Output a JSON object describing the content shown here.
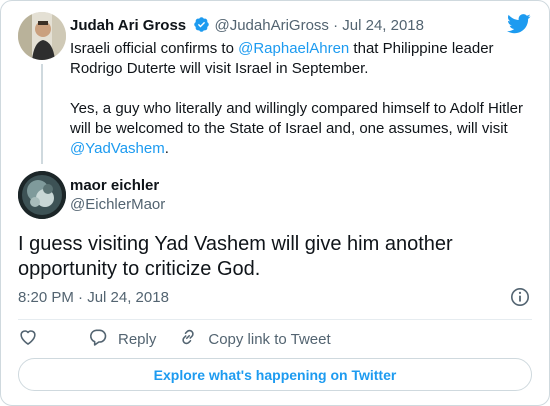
{
  "parent_tweet": {
    "author_name": "Judah Ari Gross",
    "author_handle": "@JudahAriGross",
    "separator": "·",
    "date": "Jul 24, 2018",
    "paragraph_1": {
      "before": "Israeli official confirms to ",
      "mention": "@RaphaelAhren",
      "after": " that Philippine leader Rodrigo Duterte will visit Israel in September."
    },
    "paragraph_2": {
      "before": "Yes, a guy who literally and willingly compared himself to Adolf Hitler will be welcomed to the State of Israel and, one assumes, will visit ",
      "mention": "@YadVashem",
      "after": "."
    }
  },
  "reply_tweet": {
    "author_name": "maor eichler",
    "author_handle": "@EichlerMaor",
    "text": "I guess visiting Yad Vashem will give him another opportunity to criticize God.",
    "timestamp": "8:20 PM · Jul 24, 2018"
  },
  "actions": {
    "like_icon": "heart-icon",
    "reply_icon": "reply-bubble-icon",
    "reply_label": "Reply",
    "copy_icon": "link-icon",
    "copy_label": "Copy link to Tweet"
  },
  "explore_button_label": "Explore what's happening on Twitter",
  "icons": {
    "brand": "twitter-bird-icon",
    "verified": "verified-badge-icon",
    "info": "info-icon"
  },
  "colors": {
    "accent": "#1d9bf0",
    "text": "#0f1419",
    "muted": "#536471",
    "border": "#cfd9de"
  }
}
